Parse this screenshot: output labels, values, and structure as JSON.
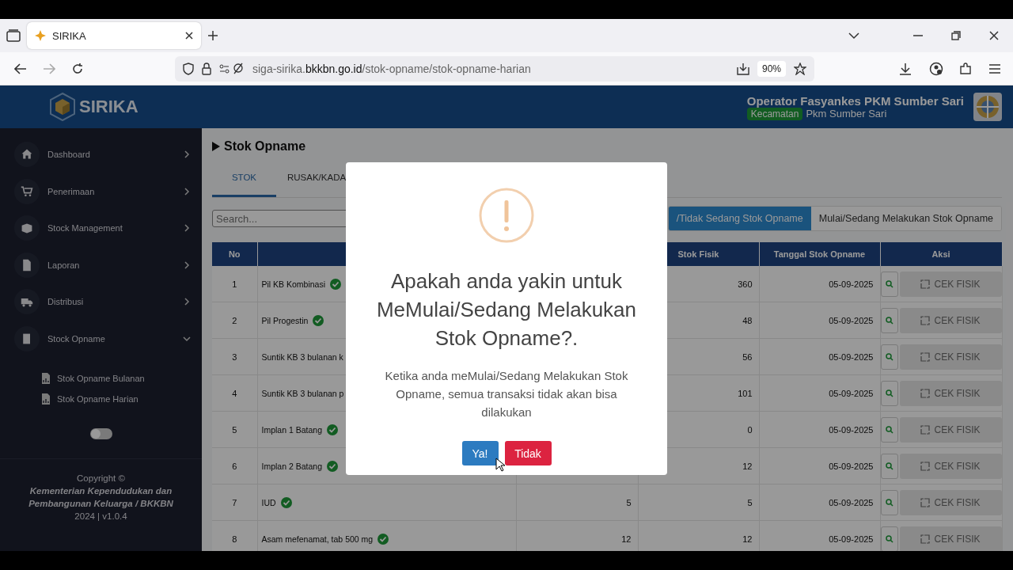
{
  "browser": {
    "tab": {
      "title": "SIRIKA",
      "selected": true
    },
    "url": {
      "subdomain": "siga-sirika.",
      "domain": "bkkbn.go.id",
      "path": "/stok-opname/stok-opname-harian"
    },
    "zoom": "90%"
  },
  "header": {
    "logo": "SIRIKA",
    "user": "Operator Fasyankes PKM Sumber Sari",
    "badge": "Kecamatan",
    "unit": "Pkm Sumber Sari"
  },
  "sidebar": {
    "items": [
      {
        "label": "Dashboard",
        "expanded": false
      },
      {
        "label": "Penerimaan",
        "expanded": false
      },
      {
        "label": "Stock Management",
        "expanded": false
      },
      {
        "label": "Laporan",
        "expanded": false
      },
      {
        "label": "Distribusi",
        "expanded": false
      },
      {
        "label": "Stock Opname",
        "expanded": true,
        "children": [
          {
            "label": "Stok Opname Bulanan"
          },
          {
            "label": "Stok Opname Harian"
          }
        ]
      }
    ],
    "toggle": {
      "on": false
    },
    "footer": {
      "copyright": "Copyright ©",
      "org": "Kementerian Kependudukan dan Pembangunan Keluarga / BKKBN",
      "version": "2024 | v1.0.4"
    }
  },
  "page": {
    "title": "Stok Opname",
    "tabs": [
      {
        "label": "STOK",
        "selected": true
      },
      {
        "label": "RUSAK/KADA",
        "selected": false
      }
    ],
    "search": {
      "placeholder": "Search..."
    },
    "status_buttons": [
      {
        "label": "/Tidak Sedang Stok Opname",
        "selected": true
      },
      {
        "label": "Mulai/Sedang Melakukan Stok Opname",
        "selected": false
      }
    ],
    "table": {
      "columns": [
        {
          "kind": "text",
          "label": "No"
        },
        {
          "kind": "blank"
        },
        {
          "kind": "blank"
        },
        {
          "kind": "text",
          "label": "Stok Fisik"
        },
        {
          "kind": "text",
          "label": "Tanggal Stok Opname"
        },
        {
          "kind": "text",
          "label": "Aksi"
        }
      ],
      "rows": [
        {
          "no": "1",
          "name": "Pil KB Kombinasi",
          "verified": true,
          "stok_fisik": "360",
          "date": "05-09-2025",
          "action": "CEK FISIK",
          "disabled": true
        },
        {
          "no": "2",
          "name": "Pil Progestin",
          "verified": true,
          "stok_fisik": "48",
          "date": "05-09-2025",
          "action": "CEK FISIK",
          "disabled": true
        },
        {
          "no": "3",
          "name": "Suntik KB 3 bulanan k",
          "verified": false,
          "stok_fisik": "56",
          "date": "05-09-2025",
          "action": "CEK FISIK",
          "disabled": true
        },
        {
          "no": "4",
          "name": "Suntik KB 3 bulanan p",
          "verified": false,
          "stok_fisik": "101",
          "date": "05-09-2025",
          "action": "CEK FISIK",
          "disabled": true
        },
        {
          "no": "5",
          "name": "Implan 1 Batang",
          "verified": true,
          "stok_fisik": "0",
          "date": "05-09-2025",
          "action": "CEK FISIK",
          "disabled": true
        },
        {
          "no": "6",
          "name": "Implan 2 Batang",
          "verified": true,
          "stok_fisik": "12",
          "date": "05-09-2025",
          "action": "CEK FISIK",
          "disabled": true
        },
        {
          "no": "7",
          "name": "IUD",
          "verified": true,
          "column_3": "5",
          "stok_fisik": "5",
          "date": "05-09-2025",
          "action": "CEK FISIK",
          "disabled": true
        },
        {
          "no": "8",
          "name": "Asam mefenamat, tab 500 mg",
          "verified": true,
          "column_3": "12",
          "stok_fisik": "12",
          "date": "05-09-2025",
          "action": "CEK FISIK",
          "disabled": true
        }
      ]
    }
  },
  "dialog": {
    "title": "Apakah anda yakin untuk MeMulai/Sedang Melakukan Stok Opname?.",
    "text": "Ketika anda meMulai/Sedang Melakukan Stok Opname, semua transaksi tidak akan bisa dilakukan",
    "buttons": [
      {
        "label": "Ya!",
        "kind": "confirm"
      },
      {
        "label": "Tidak",
        "kind": "cancel"
      }
    ]
  }
}
